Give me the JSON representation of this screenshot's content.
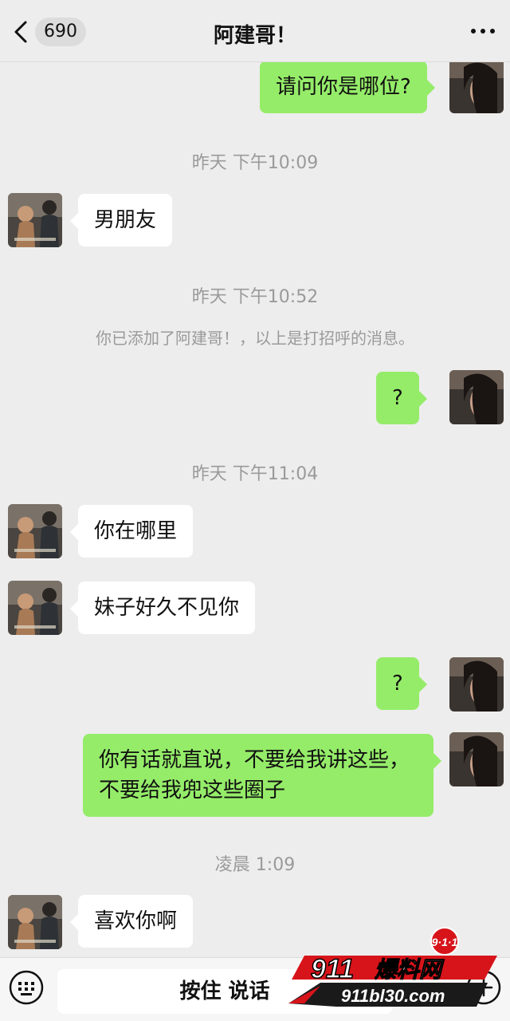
{
  "header": {
    "unread_count": "690",
    "title": "阿建哥！",
    "back_icon": "chevron-left-icon",
    "more_icon": "more-dots-icon"
  },
  "messages": [
    {
      "kind": "outgoing",
      "text": "请问你是哪位?"
    },
    {
      "kind": "timestamp",
      "text": "昨天 下午10:09"
    },
    {
      "kind": "incoming",
      "text": "男朋友"
    },
    {
      "kind": "timestamp",
      "text": "昨天 下午10:52"
    },
    {
      "kind": "system",
      "text": "你已添加了阿建哥！，以上是打招呼的消息。"
    },
    {
      "kind": "outgoing",
      "text": "?"
    },
    {
      "kind": "timestamp",
      "text": "昨天 下午11:04"
    },
    {
      "kind": "incoming",
      "text": "你在哪里"
    },
    {
      "kind": "incoming",
      "text": "妹子好久不见你"
    },
    {
      "kind": "outgoing",
      "text": "?"
    },
    {
      "kind": "outgoing",
      "text": "你有话就直说，不要给我讲这些，不要给我兜这些圈子"
    },
    {
      "kind": "timestamp",
      "text": "凌晨 1:09"
    },
    {
      "kind": "incoming",
      "text": "喜欢你啊"
    }
  ],
  "input_bar": {
    "voice_label": "按住 说话",
    "keyboard_icon": "keyboard-icon",
    "plus_icon": "plus-icon"
  },
  "watermark": {
    "badge": "9·1·1",
    "brand": "911爆料网",
    "url": "911bl30.com"
  },
  "colors": {
    "background": "#ededed",
    "outgoing_bubble": "#95ec69",
    "incoming_bubble": "#ffffff",
    "timestamp_text": "#9a9a9a",
    "watermark_red": "#d7141a"
  }
}
